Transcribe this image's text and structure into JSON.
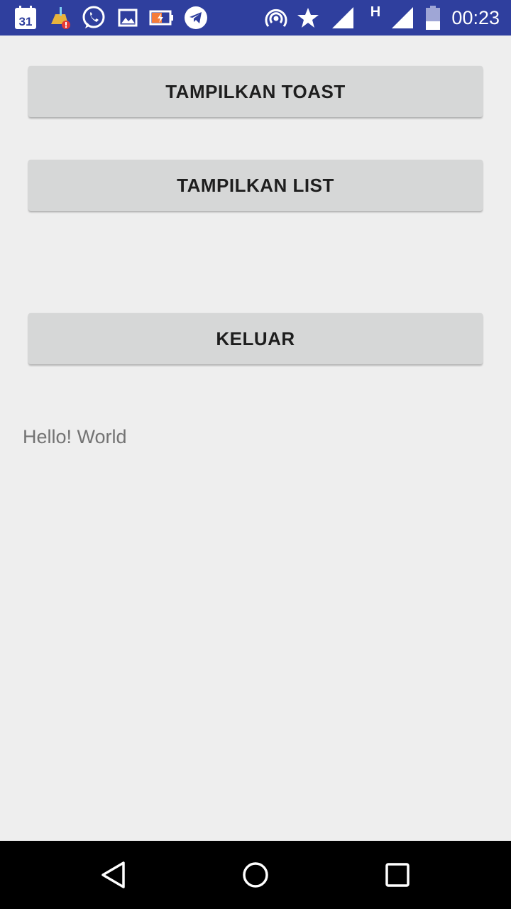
{
  "status_bar": {
    "time": "00:23",
    "calendar_day": "31",
    "network_type": "H",
    "icons": [
      "calendar-icon",
      "cleaner-icon",
      "whatsapp-icon",
      "gallery-icon",
      "battery-saver-icon",
      "telegram-icon",
      "hotspot-icon",
      "star-icon",
      "signal-icon",
      "signal-icon",
      "battery-icon"
    ],
    "background_color": "#2f3f9e"
  },
  "main": {
    "buttons": {
      "toast_label": "TAMPILKAN TOAST",
      "list_label": "TAMPILKAN LIST",
      "exit_label": "KELUAR"
    },
    "hello_text": "Hello! World"
  },
  "navigation_bar": {
    "icons": [
      "back-icon",
      "home-icon",
      "recents-icon"
    ]
  }
}
